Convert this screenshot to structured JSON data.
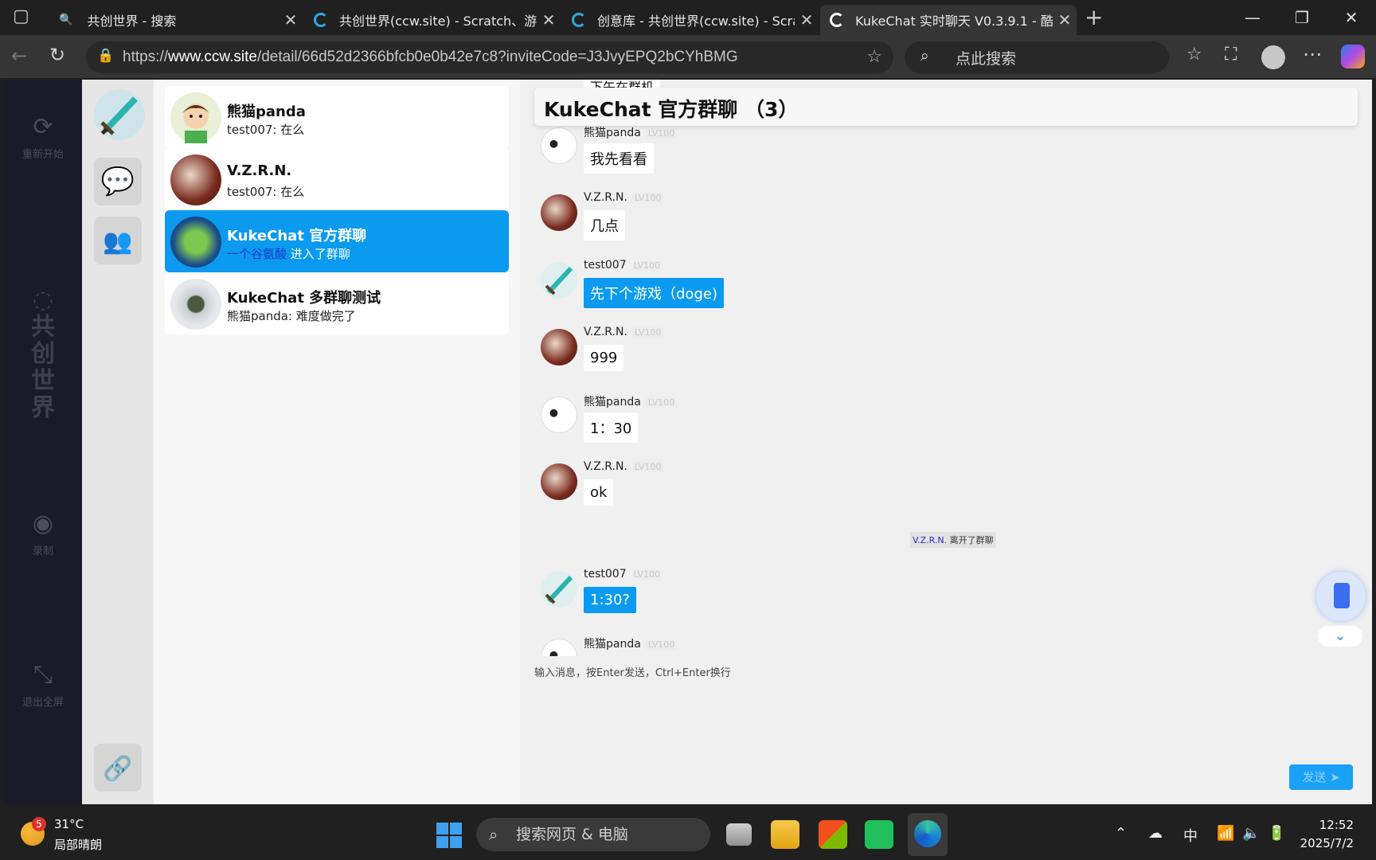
{
  "browser": {
    "tabs": [
      {
        "title": "共创世界 - 搜索"
      },
      {
        "title": "共创世界(ccw.site) - Scratch、游戏"
      },
      {
        "title": "创意库 - 共创世界(ccw.site) - Scratch"
      },
      {
        "title": "KukeChat 实时聊天 V0.3.9.1 - 酷可"
      }
    ],
    "url_prefix": "https://",
    "url_host": "www.ccw.site",
    "url_path": "/detail/66d52d2366bfcb0e0b42e7c8?inviteCode=J3JvyEPQ2bCYhBMG",
    "search_placeholder": "点此搜索"
  },
  "rail": {
    "restart_label": "重新开始",
    "brand": "共\n创\n世\n界",
    "record_label": "录制",
    "exit_fullscreen_label": "退出全屏"
  },
  "conversations": [
    {
      "name": "熊猫panda",
      "preview": "test007: 在么"
    },
    {
      "name": "V.Z.R.N.",
      "preview": "test007: 在么"
    },
    {
      "name": "KukeChat 官方群聊",
      "preview_highlight": "一个谷氨酸",
      "preview_rest": " 进入了群聊"
    },
    {
      "name": "KukeChat 多群聊测试",
      "preview": "熊猫panda: 难度做完了"
    }
  ],
  "chat": {
    "title": "KukeChat 官方群聊 （3）",
    "partial_top_text": "下午在群机",
    "messages": [
      {
        "sender": "熊猫panda",
        "level": "LV100",
        "text": "我先看看"
      },
      {
        "sender": "V.Z.R.N.",
        "level": "LV100",
        "text": "几点"
      },
      {
        "sender": "test007",
        "level": "LV100",
        "text": "先下个游戏（doge)"
      },
      {
        "sender": "V.Z.R.N.",
        "level": "LV100",
        "text": "999"
      },
      {
        "sender": "熊猫panda",
        "level": "LV100",
        "text": "1：30"
      },
      {
        "sender": "V.Z.R.N.",
        "level": "LV100",
        "text": "ok"
      },
      {
        "sender": "test007",
        "level": "LV100",
        "text": "1:30?"
      },
      {
        "sender": "熊猫panda",
        "level": "LV100",
        "text": ""
      }
    ],
    "system_note_name": "V.Z.R.N.",
    "system_note_rest": " 离开了群聊",
    "input_hint": "输入消息，按Enter发送，Ctrl+Enter换行",
    "send_label": "发送 ➤"
  },
  "taskbar": {
    "weather_badge": "5",
    "temperature": "31°C",
    "weather_desc": "局部晴朗",
    "search_text": "搜索网页 & 电脑",
    "ime": "中",
    "time": "12:52",
    "date": "2025/7/2"
  },
  "colors": {
    "accent": "#0b9af0",
    "rail_bg": "#1a1a2a"
  }
}
